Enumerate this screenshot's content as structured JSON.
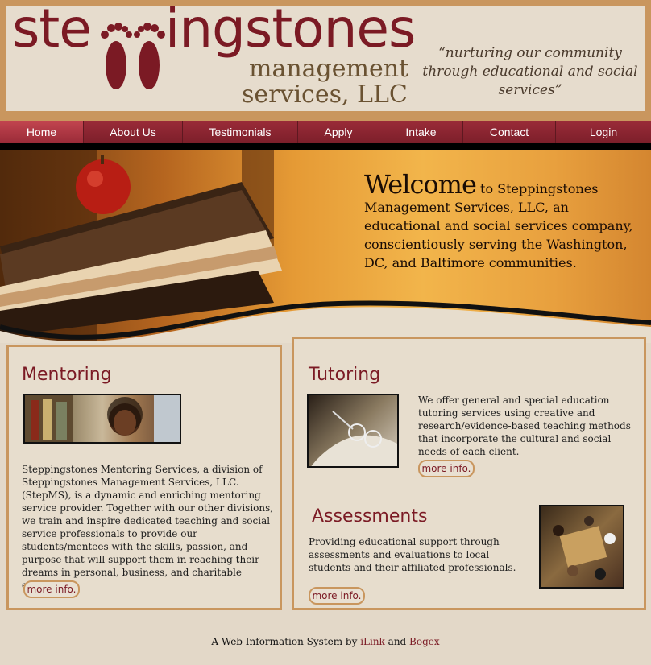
{
  "header": {
    "logo_left": "ste",
    "logo_right": "ingstones",
    "logo_line2": "management",
    "logo_line3": "services, LLC",
    "tagline": "“nurturing our community through educational and social services”"
  },
  "nav": {
    "items": [
      {
        "label": "Home",
        "active": true
      },
      {
        "label": "About Us"
      },
      {
        "label": "Testimonials"
      },
      {
        "label": "Apply"
      },
      {
        "label": "Intake"
      },
      {
        "label": "Contact"
      },
      {
        "label": "Login"
      }
    ]
  },
  "hero": {
    "welcome_big": "Welcome",
    "welcome_text": " to Steppingstones Management Services, LLC, an educational and social services company, conscientiously serving the Washington, DC, and Baltimore communities."
  },
  "mentoring": {
    "title": "Mentoring",
    "body": "Steppingstones Mentoring Services, a division of Steppingstones Management Services, LLC. (StepMS), is a dynamic and enriching mentoring service provider. Together with our other divisions, we train and inspire dedicated teaching and social service professionals to provide our students/mentees with the skills, passion, and purpose that will support them in reaching their dreams in personal, business, and charitable endeavors.",
    "more": "more info."
  },
  "tutoring": {
    "title": "Tutoring",
    "body": "We offer general and special education tutoring services using creative and research/evidence-based teaching methods that incorporate the cultural and social needs of each client.",
    "more": "more info."
  },
  "assessments": {
    "title": "Assessments",
    "body": "Providing educational support through assessments and evaluations to local students and their affiliated professionals.",
    "more": "more info."
  },
  "footer": {
    "prefix": "A Web Information System by ",
    "link1": "iLink",
    "middle": " and ",
    "link2": "Bogex"
  },
  "colors": {
    "brand_maroon": "#7b1a24",
    "accent_tan": "#c9965e",
    "nav_bg": "#8a2430"
  }
}
